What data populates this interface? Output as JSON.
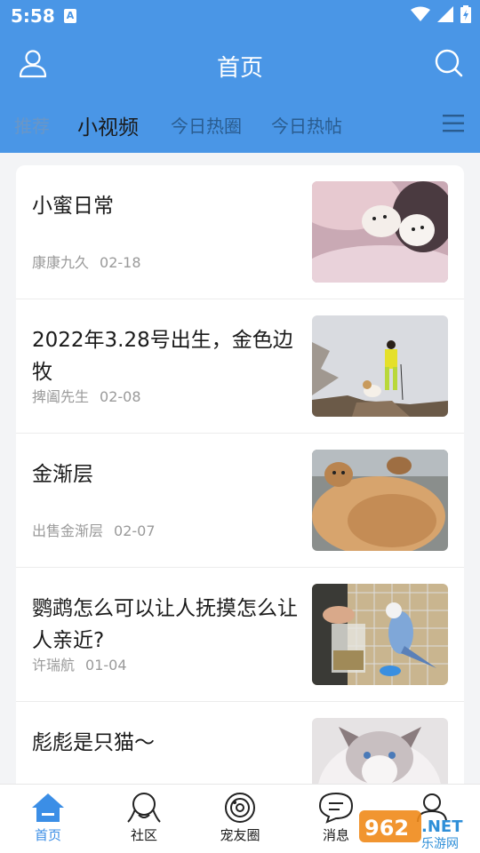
{
  "status": {
    "time": "5:58",
    "notif_glyph": "A"
  },
  "header": {
    "title": "首页"
  },
  "tabs": [
    {
      "label": "推荐"
    },
    {
      "label": "小视频"
    },
    {
      "label": "今日热圈"
    },
    {
      "label": "今日热帖"
    }
  ],
  "feed": {
    "items": [
      {
        "title": "小蜜日常",
        "author": "康康九久",
        "date": "02-18",
        "thumb": "puppy-photo"
      },
      {
        "title": "2022年3.28号出生，金色边牧",
        "author": "捭阖先生",
        "date": "02-08",
        "thumb": "hiker-with-dog-photo"
      },
      {
        "title": "金渐层",
        "author": "出售金渐层",
        "date": "02-07",
        "thumb": "cat-photo"
      },
      {
        "title": "鹦鹉怎么可以让人抚摸怎么让人亲近?",
        "author": "许瑞航",
        "date": "01-04",
        "thumb": "parrot-photo"
      },
      {
        "title": "彪彪是只猫～",
        "author": "",
        "date": "",
        "thumb": "ragdoll-cat-photo"
      }
    ]
  },
  "bottom_nav": [
    {
      "label": "首页",
      "icon": "home-icon"
    },
    {
      "label": "社区",
      "icon": "community-icon"
    },
    {
      "label": "宠友圈",
      "icon": "pet-circle-icon"
    },
    {
      "label": "消息",
      "icon": "message-icon"
    },
    {
      "label": "",
      "icon": "profile-icon"
    }
  ],
  "watermark": {
    "top": "962",
    "bottom": ".NET",
    "sub": "乐游网"
  },
  "colors": {
    "primary": "#4a96e6",
    "active_tab_text": "#1a1a1a",
    "nav_active": "#3b8ee6"
  }
}
